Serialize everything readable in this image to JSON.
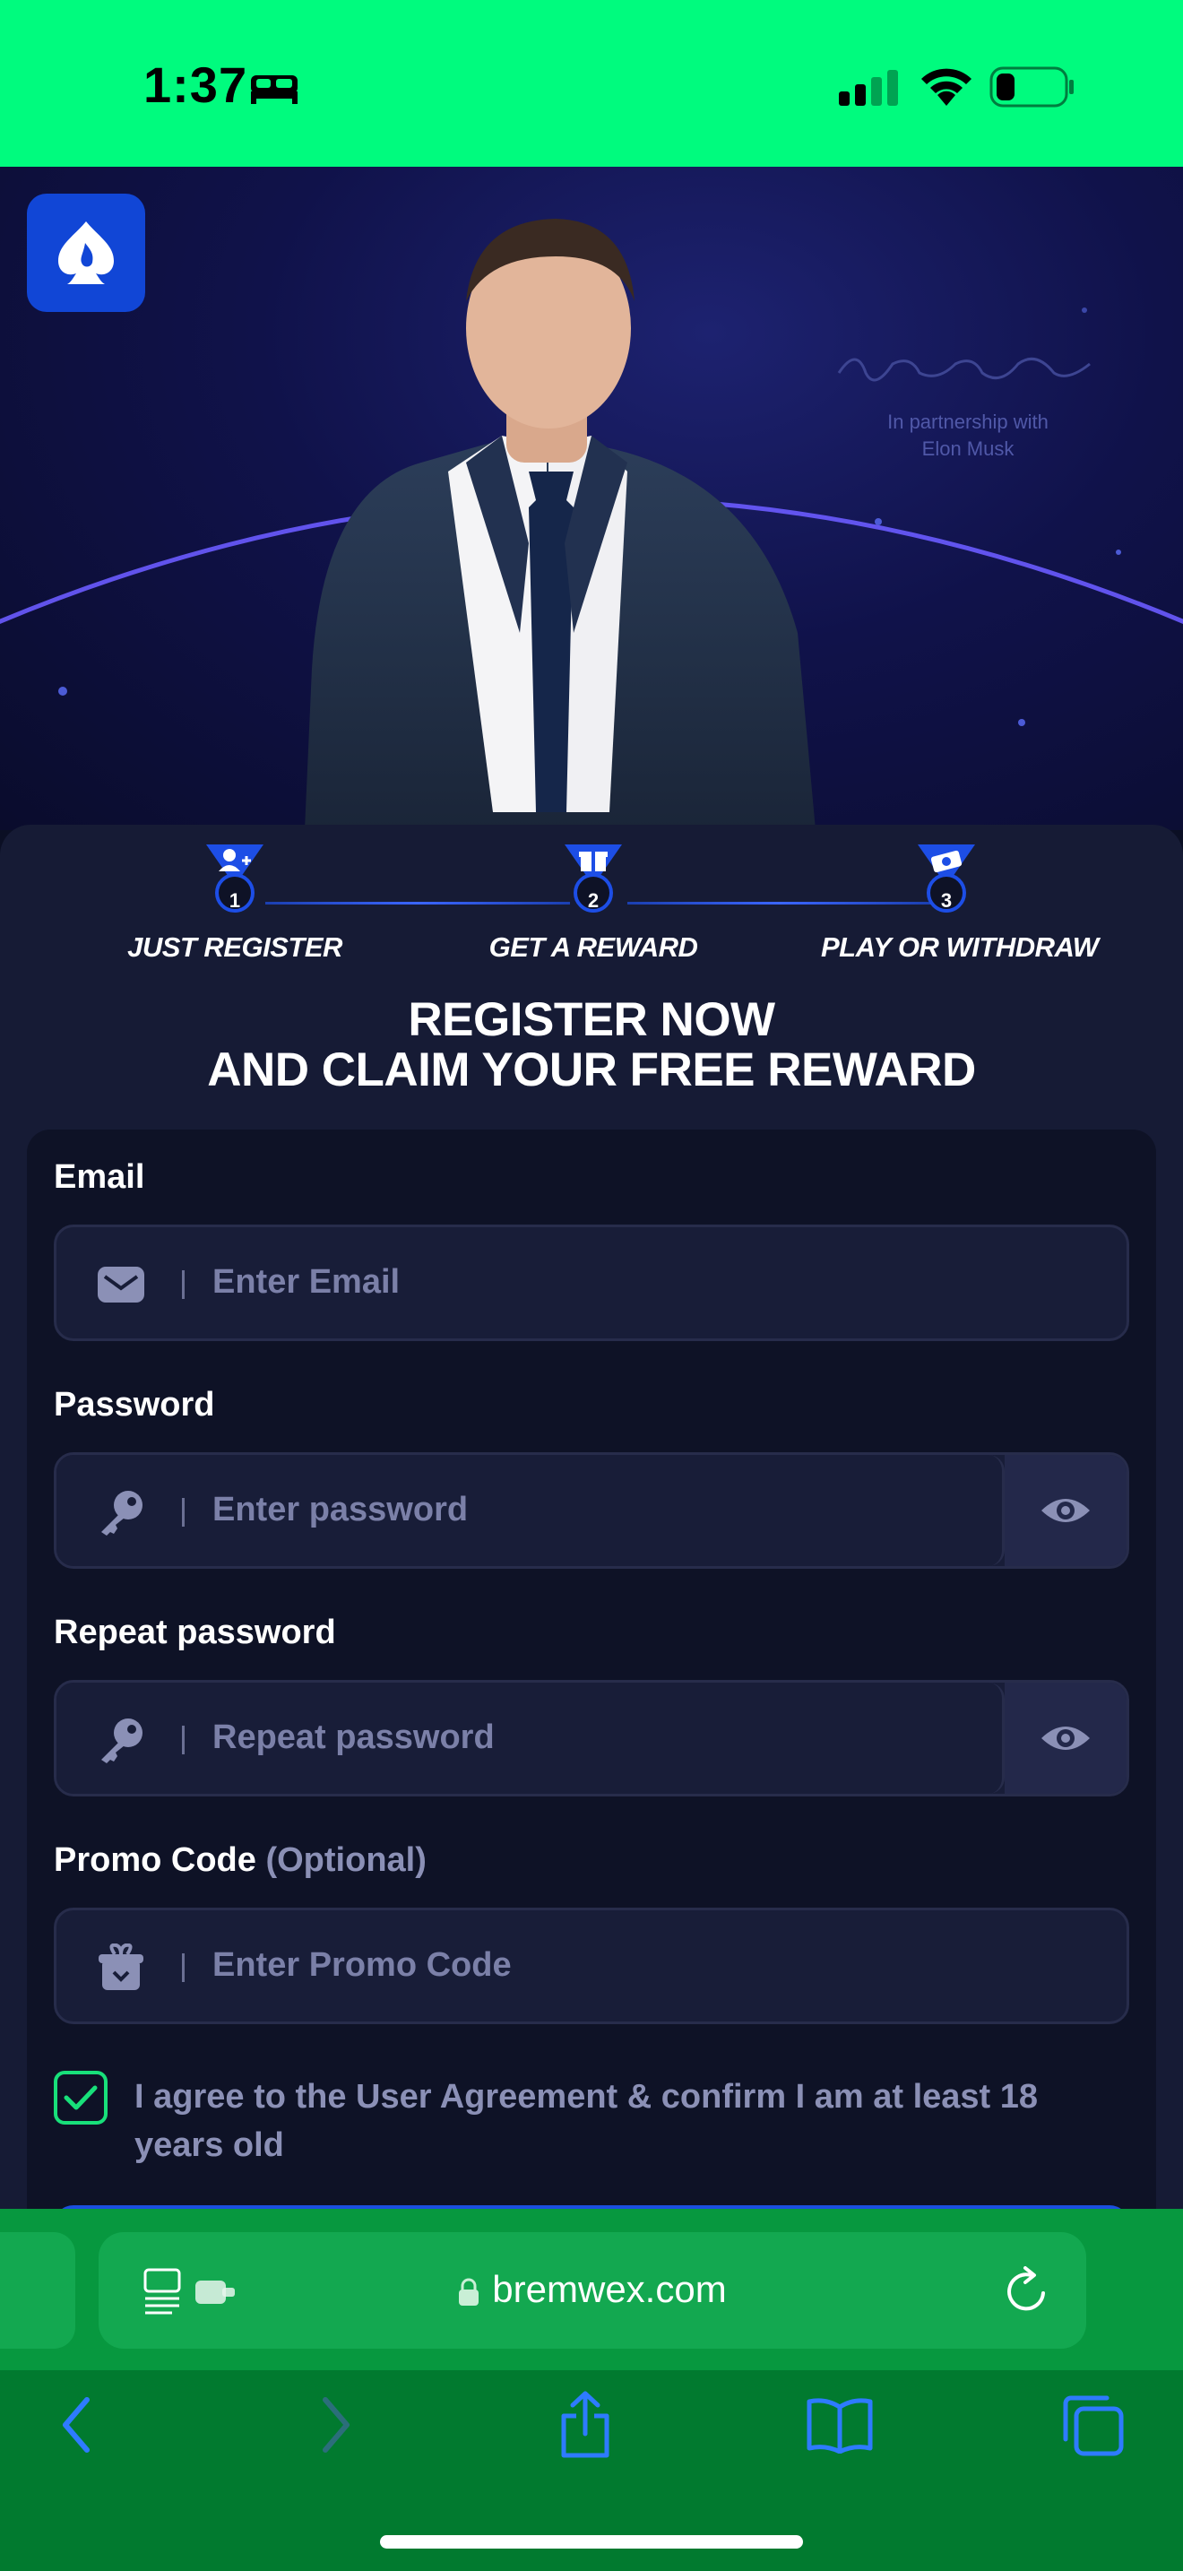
{
  "status_bar": {
    "time": "1:37",
    "icons": [
      "sleep-focus-icon",
      "cellular-signal-icon",
      "wifi-icon",
      "battery-low-icon"
    ],
    "background": "#00fb7e"
  },
  "hero": {
    "logo_icon": "spade-flame-icon",
    "partner_text_line1": "In partnership with",
    "partner_text_line2": "Elon Musk",
    "image": "portrait-man-suit"
  },
  "steps": [
    {
      "number": "1",
      "label": "JUST REGISTER",
      "icon": "add-user-icon"
    },
    {
      "number": "2",
      "label": "GET A REWARD",
      "icon": "gift-icon"
    },
    {
      "number": "3",
      "label": "PLAY OR WITHDRAW",
      "icon": "cash-icon"
    }
  ],
  "headline": {
    "line1": "REGISTER NOW",
    "line2": "AND CLAIM YOUR FREE REWARD"
  },
  "form": {
    "email": {
      "label": "Email",
      "placeholder": "Enter Email",
      "icon": "mail-icon"
    },
    "password": {
      "label": "Password",
      "placeholder": "Enter password",
      "icon": "key-icon",
      "toggle_icon": "eye-icon"
    },
    "repeat_password": {
      "label": "Repeat password",
      "placeholder": "Repeat password",
      "icon": "key-icon",
      "toggle_icon": "eye-icon"
    },
    "promo": {
      "label": "Promo Code",
      "optional": "(Optional)",
      "placeholder": "Enter Promo Code",
      "icon": "gift-box-icon"
    },
    "agree": {
      "checked": true,
      "text": "I agree to the User Agreement & confirm I am at least 18 years old"
    }
  },
  "browser": {
    "url": "bremwex.com",
    "background": "#017a2f"
  },
  "colors": {
    "accent_blue": "#1146d6",
    "check_green": "#18e07a",
    "panel": "#0e1226",
    "card": "#161b35"
  }
}
